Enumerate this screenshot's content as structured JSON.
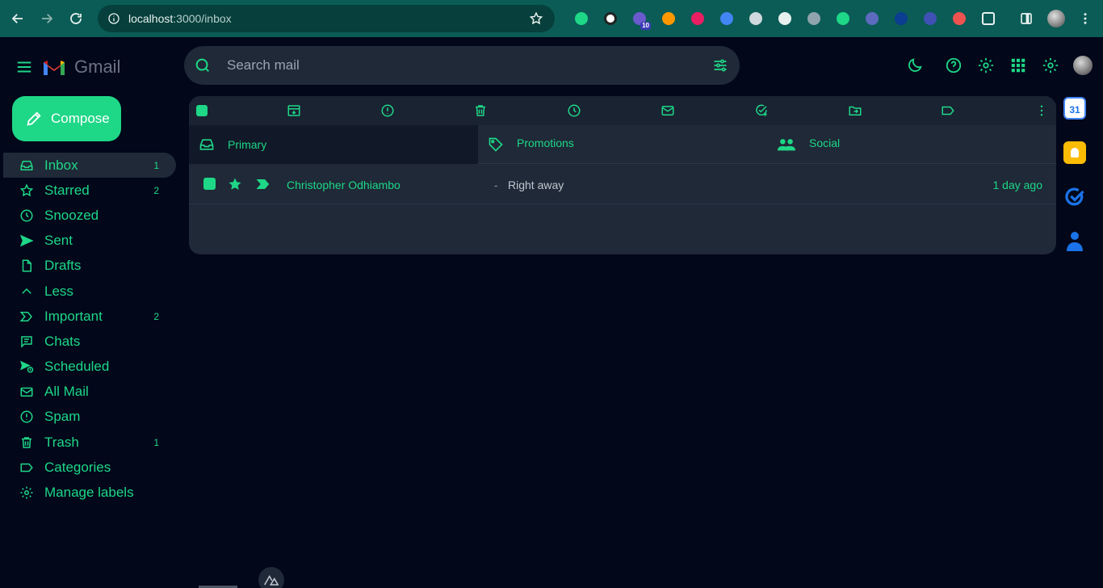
{
  "browser": {
    "url_host": "localhost",
    "url_path": ":3000/inbox",
    "extensions": [
      "nuxt-devtools-icon",
      "clock-icon",
      "ext-badge-icon",
      "color-ring-icon",
      "instagram-like-icon",
      "doc-icon",
      "target-icon",
      "react-icon",
      "shield-icon",
      "fish-icon",
      "gear-blue-icon",
      "check-icon",
      "bolt-icon",
      "bookmark-icon",
      "puzzle-icon"
    ],
    "extension_badge": "10"
  },
  "app": {
    "logo_text": "Gmail",
    "search_placeholder": "Search mail",
    "compose_label": "Compose"
  },
  "sidebar": {
    "items": [
      {
        "label": "Inbox",
        "count": "1",
        "icon": "inbox-icon"
      },
      {
        "label": "Starred",
        "count": "2",
        "icon": "star-icon"
      },
      {
        "label": "Snoozed",
        "count": "",
        "icon": "clock-icon"
      },
      {
        "label": "Sent",
        "count": "",
        "icon": "send-icon"
      },
      {
        "label": "Drafts",
        "count": "",
        "icon": "draft-icon"
      },
      {
        "label": "Less",
        "count": "",
        "icon": "chevron-up-icon"
      },
      {
        "label": "Important",
        "count": "2",
        "icon": "important-icon"
      },
      {
        "label": "Chats",
        "count": "",
        "icon": "chat-icon"
      },
      {
        "label": "Scheduled",
        "count": "",
        "icon": "scheduled-icon"
      },
      {
        "label": "All Mail",
        "count": "",
        "icon": "all-mail-icon"
      },
      {
        "label": "Spam",
        "count": "",
        "icon": "spam-icon"
      },
      {
        "label": "Trash",
        "count": "1",
        "icon": "trash-icon"
      },
      {
        "label": "Categories",
        "count": "",
        "icon": "label-icon"
      },
      {
        "label": "Manage labels",
        "count": "",
        "icon": "gear-icon"
      }
    ]
  },
  "tabs": [
    {
      "label": "Primary",
      "icon": "inbox-icon"
    },
    {
      "label": "Promotions",
      "icon": "tag-icon"
    },
    {
      "label": "Social",
      "icon": "people-icon"
    }
  ],
  "emails": [
    {
      "sender": "Christopher Odhiambo",
      "separator": "-",
      "subject": "Right away",
      "date": "1 day ago"
    }
  ],
  "colors": {
    "accent": "#1ed787",
    "background": "#02071a",
    "panel": "#1f2937",
    "chrome": "#0b5c56"
  }
}
